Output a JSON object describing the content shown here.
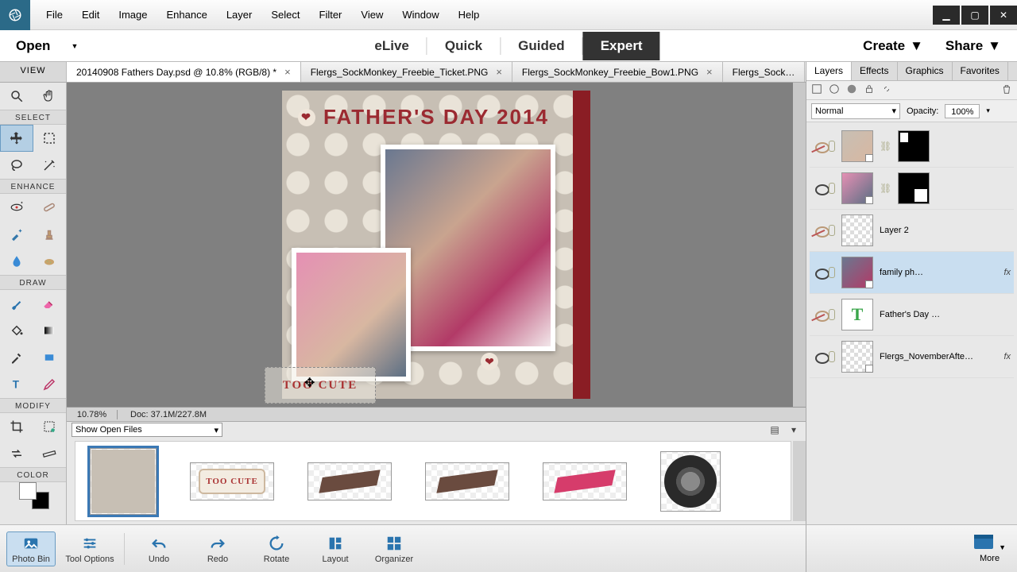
{
  "menu": {
    "file": "File",
    "edit": "Edit",
    "image": "Image",
    "enhance": "Enhance",
    "layer": "Layer",
    "select": "Select",
    "filter": "Filter",
    "view": "View",
    "window": "Window",
    "help": "Help"
  },
  "appbar": {
    "open": "Open",
    "elive": "eLive",
    "quick": "Quick",
    "guided": "Guided",
    "expert": "Expert",
    "create": "Create",
    "share": "Share"
  },
  "viewlabel": "VIEW",
  "doctabs": [
    {
      "title": "20140908 Fathers Day.psd @ 10.8% (RGB/8) *",
      "active": true
    },
    {
      "title": "Flergs_SockMonkey_Freebie_Ticket.PNG",
      "active": false
    },
    {
      "title": "Flergs_SockMonkey_Freebie_Bow1.PNG",
      "active": false
    },
    {
      "title": "Flergs_Sock…",
      "active": false,
      "noclose": true
    }
  ],
  "toolbox": {
    "select": "SELECT",
    "enhance": "ENHANCE",
    "draw": "DRAW",
    "modify": "MODIFY",
    "color": "COLOR"
  },
  "canvas": {
    "title_prefix": "FATHER'S DAY 2014",
    "drag_label": "TOO CUTE",
    "zoom": "10.78%",
    "docinfo": "Doc: 37.1M/227.8M"
  },
  "bin": {
    "combo": "Show Open Files"
  },
  "bottom": {
    "photobin": "Photo Bin",
    "tooloptions": "Tool Options",
    "undo": "Undo",
    "redo": "Redo",
    "rotate": "Rotate",
    "layout": "Layout",
    "organizer": "Organizer",
    "more": "More"
  },
  "rightpanel": {
    "tabs": {
      "layers": "Layers",
      "effects": "Effects",
      "graphics": "Graphics",
      "favorites": "Favorites"
    },
    "blend": "Normal",
    "opacity_lbl": "Opacity:",
    "opacity_val": "100%",
    "layers": [
      {
        "name": "",
        "mask": "tl",
        "visible": false
      },
      {
        "name": "",
        "mask": "br",
        "visible": true
      },
      {
        "name": "Layer 2",
        "checker": true,
        "visible": false
      },
      {
        "name": "family ph…",
        "fx": true,
        "visible": true
      },
      {
        "name": "Father's Day …",
        "text": true,
        "visible": false
      },
      {
        "name": "Flergs_NovemberAfte…",
        "fx": true,
        "smart": true,
        "visible": true
      }
    ]
  },
  "thumbs": {
    "toocute": "TOO CUTE"
  }
}
